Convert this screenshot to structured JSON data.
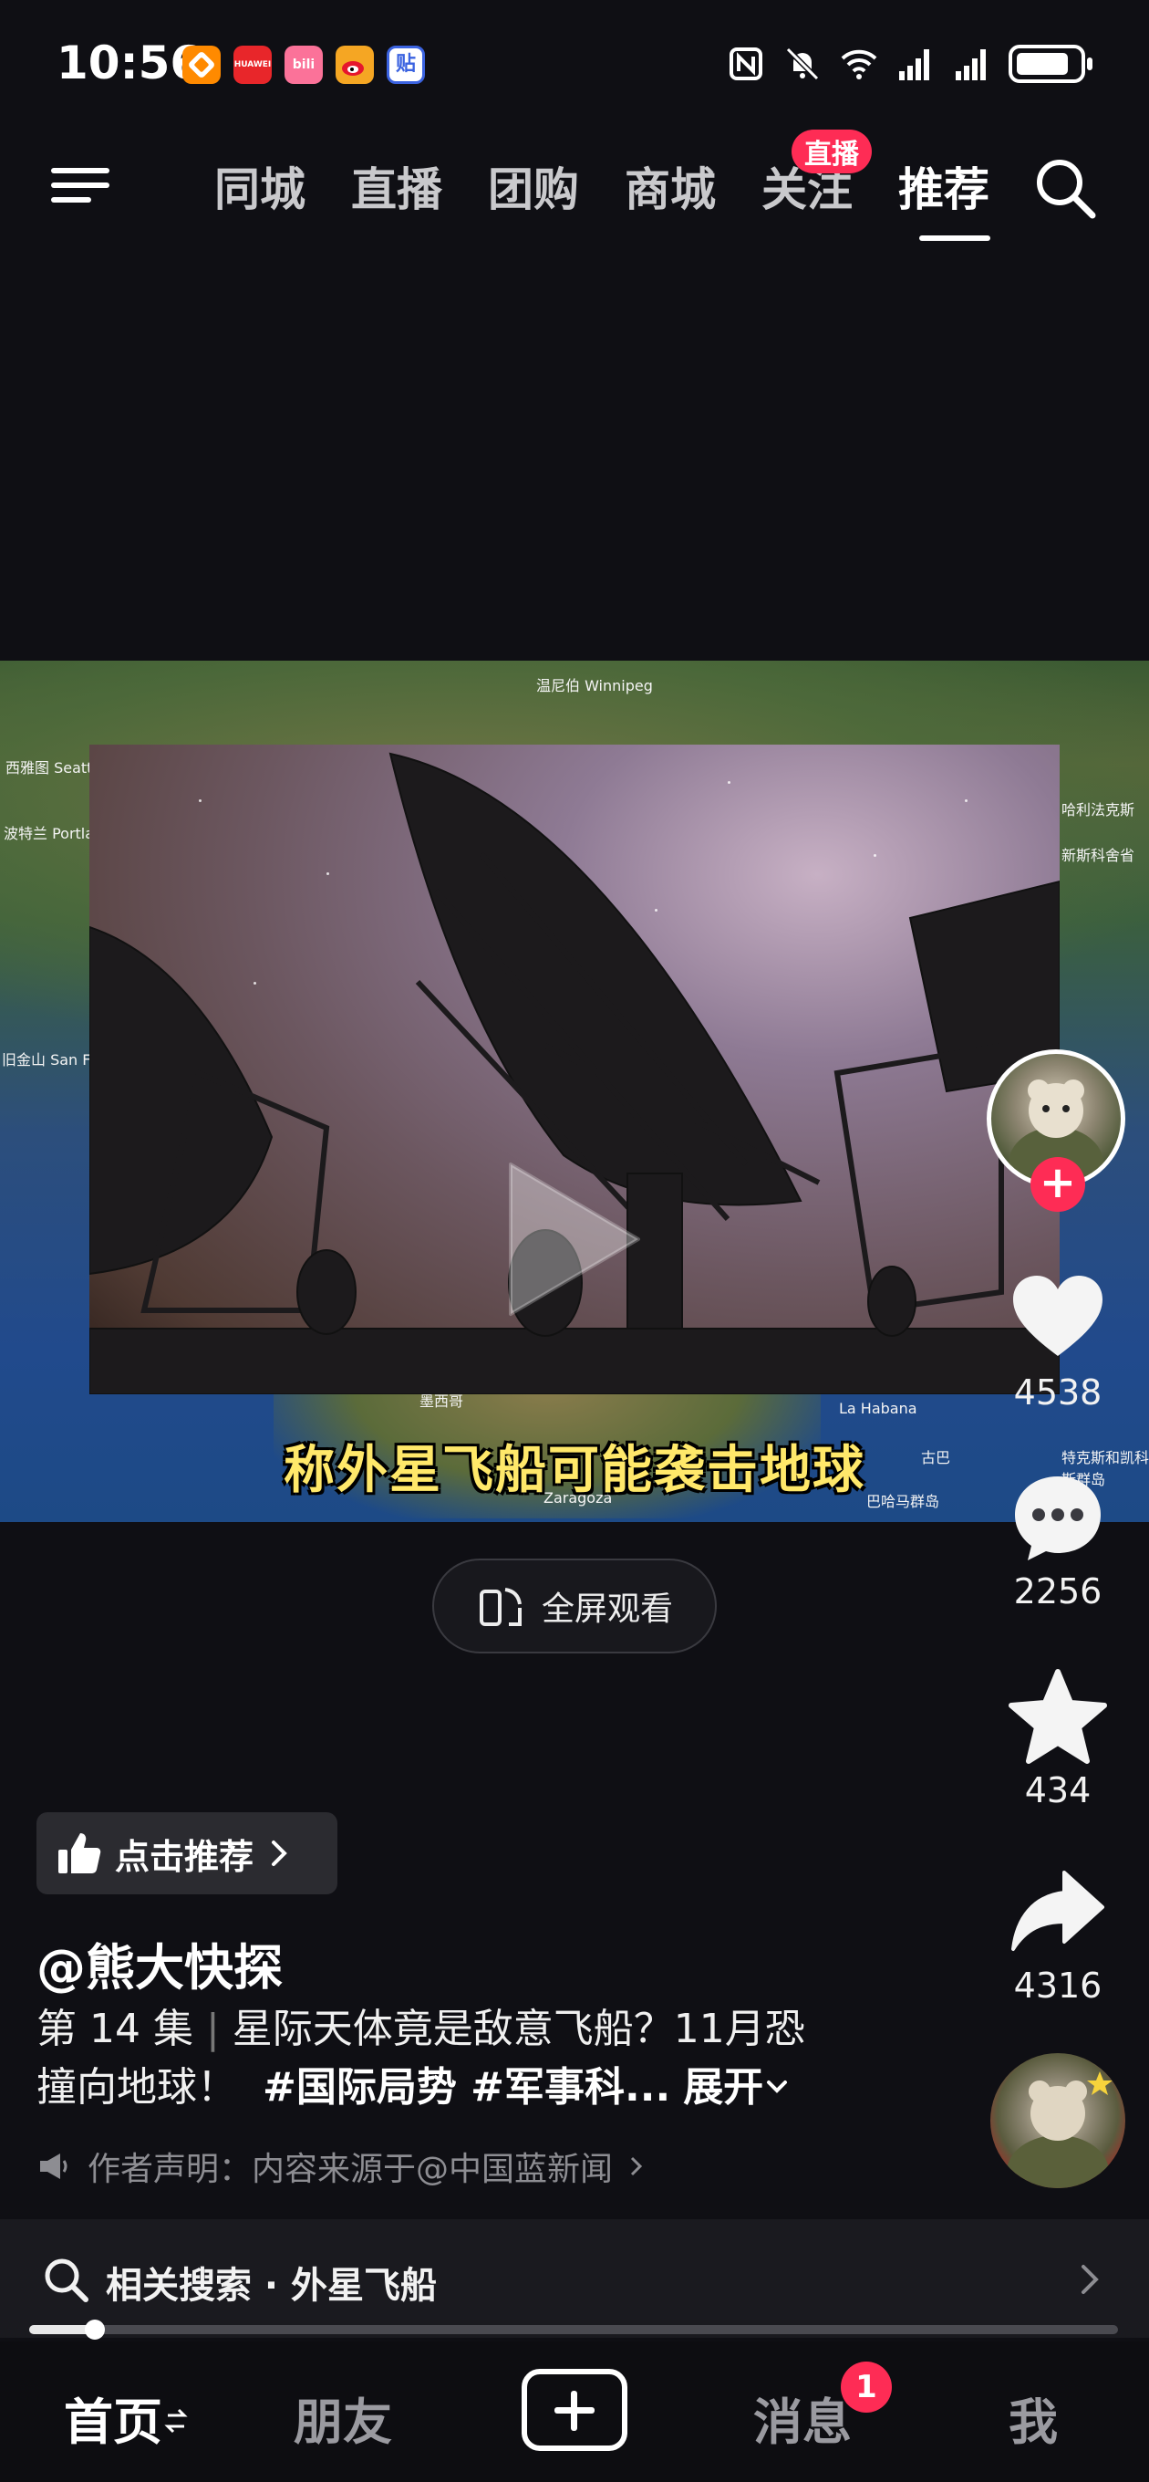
{
  "status_bar": {
    "time": "10:56",
    "app_icons": [
      {
        "name": "taobao-app-icon",
        "label": "",
        "color": "#ff8a00"
      },
      {
        "name": "huawei-store-icon",
        "label": "HUAWEI",
        "color": "#e8262a"
      },
      {
        "name": "bilibili-icon",
        "label": "bili",
        "color": "#fb7299"
      },
      {
        "name": "weibo-icon",
        "label": "",
        "color": "#f5a623"
      },
      {
        "name": "tieba-icon",
        "label": "贴",
        "color": "#3b63e0"
      }
    ]
  },
  "top_nav": {
    "tabs": [
      "同城",
      "直播",
      "团购",
      "商城",
      "关注",
      "推荐"
    ],
    "active_tab": "推荐",
    "live_badge": "直播"
  },
  "video": {
    "subtitle": "称外星飞船可能袭击地球",
    "map_labels": [
      "温尼伯 Winnipeg",
      "西雅图 Seattle",
      "波特兰 Portland",
      "旧金山 San Francisco",
      "墨西哥",
      "La Habana",
      "古巴",
      "巴哈马群岛",
      "特克斯和凯科斯群岛",
      "新斯科舍省",
      "哈利法克斯",
      "Zaragoza"
    ]
  },
  "fullscreen_label": "全屏观看",
  "rail": {
    "likes": "4538",
    "comments": "2256",
    "favorites": "434",
    "shares": "4316"
  },
  "recommend_label": "点击推荐",
  "author": "@熊大快探",
  "description": {
    "episode": "第 14 集",
    "text_line1": "星际天体竟是敌意飞船？11月恐",
    "text_line2": "撞向地球！",
    "tags": "#国际局势 #军事科...",
    "expand": "展开"
  },
  "notice": "作者声明：内容来源于@中国蓝新闻",
  "related_search": "相关搜索 · 外星飞船",
  "progress_fraction": 0.06,
  "bottom_nav": {
    "home": "首页",
    "friends": "朋友",
    "messages": "消息",
    "messages_badge": "1",
    "me": "我"
  },
  "colors": {
    "accent_red": "#fe2c55",
    "subtitle_yellow": "#ffe86a",
    "background": "#0f0f14"
  }
}
